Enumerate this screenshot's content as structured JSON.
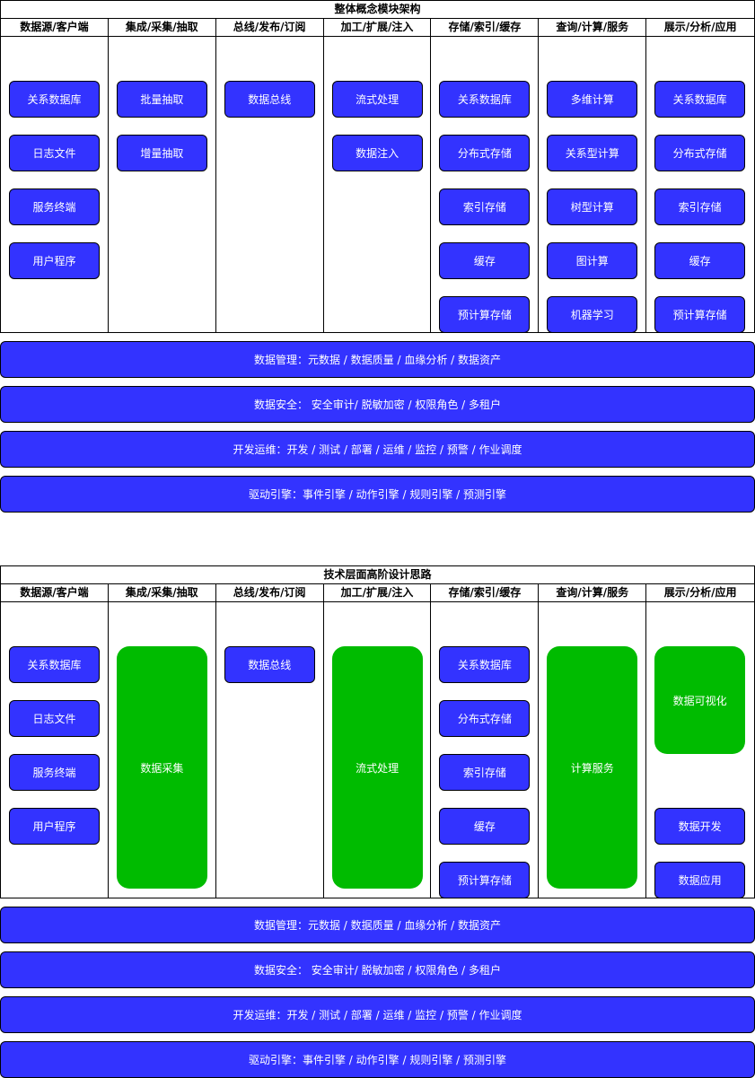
{
  "diagram1": {
    "title": "整体概念模块架构",
    "columns": [
      {
        "header": "数据源/客户端",
        "items": [
          "关系数据库",
          "日志文件",
          "服务终端",
          "用户程序"
        ]
      },
      {
        "header": "集成/采集/抽取",
        "items": [
          "批量抽取",
          "增量抽取"
        ]
      },
      {
        "header": "总线/发布/订阅",
        "items": [
          "数据总线"
        ]
      },
      {
        "header": "加工/扩展/注入",
        "items": [
          "流式处理",
          "数据注入"
        ]
      },
      {
        "header": "存储/索引/缓存",
        "items": [
          "关系数据库",
          "分布式存储",
          "索引存储",
          "缓存",
          "预计算存储"
        ]
      },
      {
        "header": "查询/计算/服务",
        "items": [
          "多维计算",
          "关系型计算",
          "树型计算",
          "图计算",
          "机器学习"
        ]
      },
      {
        "header": "展示/分析/应用",
        "items": [
          "关系数据库",
          "分布式存储",
          "索引存储",
          "缓存",
          "预计算存储"
        ]
      }
    ],
    "bars": [
      "数据管理：元数据 / 数据质量 / 血缘分析 / 数据资产",
      "数据安全： 安全审计/ 脱敏加密 / 权限角色 / 多租户",
      "开发运维：开发 / 测试 / 部署 / 运维 / 监控 / 预警 / 作业调度",
      "驱动引擎：事件引擎 / 动作引擎 / 规则引擎 / 预测引擎"
    ]
  },
  "diagram2": {
    "title": "技术层面高阶设计思路",
    "columns": [
      {
        "header": "数据源/客户端",
        "items": [
          "关系数据库",
          "日志文件",
          "服务终端",
          "用户程序"
        ]
      },
      {
        "header": "集成/采集/抽取",
        "big": "数据采集"
      },
      {
        "header": "总线/发布/订阅",
        "items": [
          "数据总线"
        ]
      },
      {
        "header": "加工/扩展/注入",
        "big": "流式处理"
      },
      {
        "header": "存储/索引/缓存",
        "items": [
          "关系数据库",
          "分布式存储",
          "索引存储",
          "缓存",
          "预计算存储"
        ]
      },
      {
        "header": "查询/计算/服务",
        "big": "计算服务"
      },
      {
        "header": "展示/分析/应用",
        "visual": "数据可视化",
        "items": [
          "数据开发",
          "数据应用"
        ]
      }
    ],
    "bars": [
      "数据管理：元数据 / 数据质量 / 血缘分析 / 数据资产",
      "数据安全： 安全审计/ 脱敏加密 / 权限角色 / 多租户",
      "开发运维：开发 / 测试 / 部署 / 运维 / 监控 / 预警 / 作业调度",
      "驱动引擎：事件引擎 / 动作引擎 / 规则引擎 / 预测引擎"
    ]
  },
  "colors": {
    "box_blue": "#3333ff",
    "box_green": "#00bb00"
  }
}
